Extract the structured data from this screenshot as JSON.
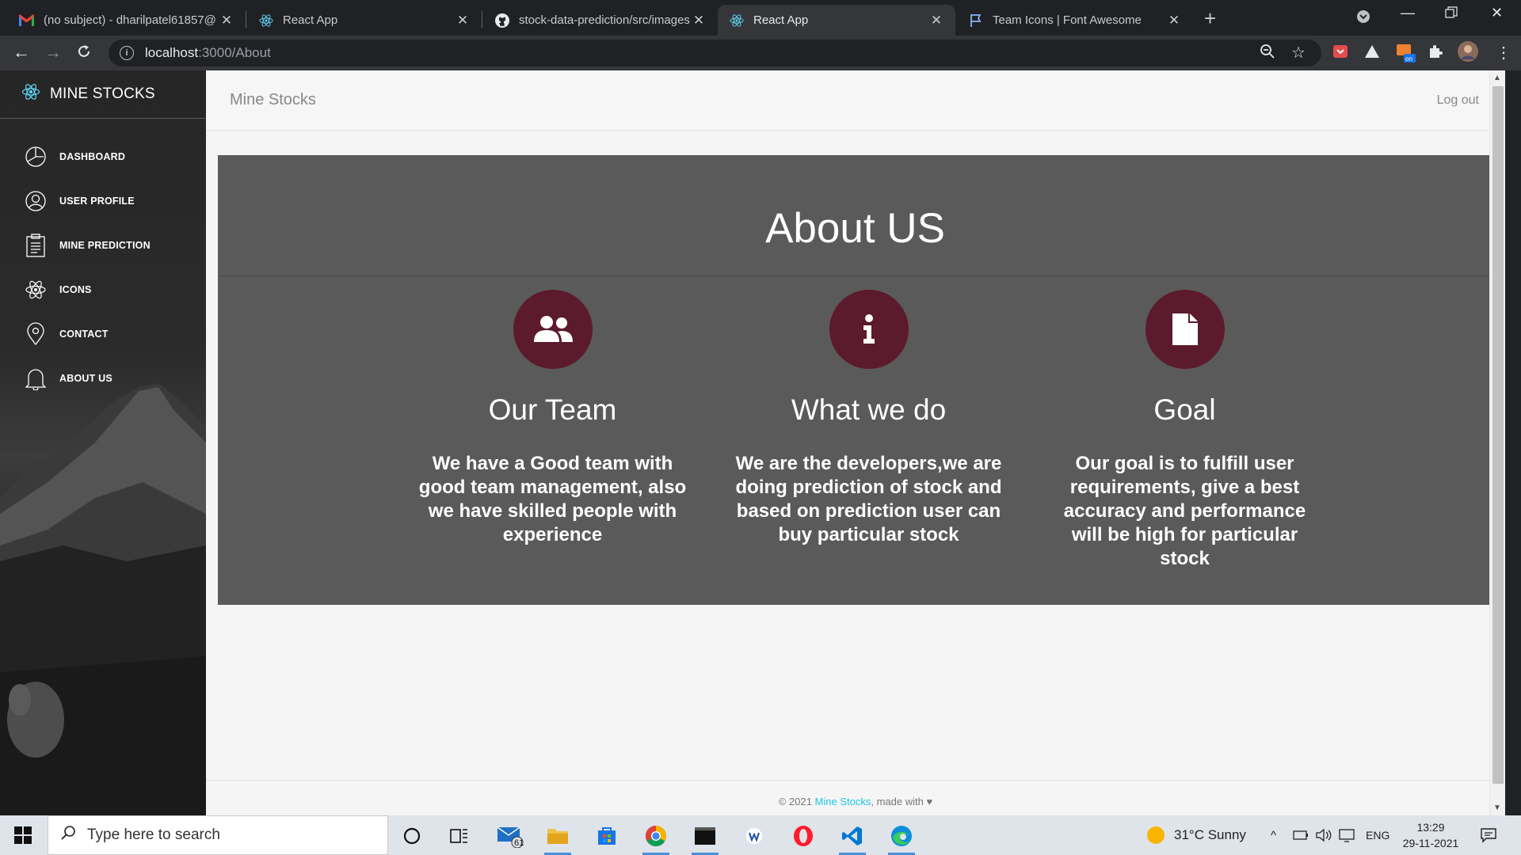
{
  "browser": {
    "tabs": [
      {
        "title": "(no subject) - dharilpatel61857@",
        "icon": "gmail-icon",
        "active": false
      },
      {
        "title": "React App",
        "icon": "react-icon",
        "active": false
      },
      {
        "title": "stock-data-prediction/src/images",
        "icon": "github-icon",
        "active": false
      },
      {
        "title": "React App",
        "icon": "react-icon",
        "active": true
      },
      {
        "title": "Team Icons | Font Awesome",
        "icon": "flag-icon",
        "active": false
      }
    ],
    "url_host": "localhost",
    "url_path": ":3000/About"
  },
  "sidebar": {
    "brand": "MINE STOCKS",
    "items": [
      {
        "label": "DASHBOARD",
        "icon": "pie-chart-icon"
      },
      {
        "label": "USER PROFILE",
        "icon": "user-circle-icon"
      },
      {
        "label": "MINE PREDICTION",
        "icon": "clipboard-icon"
      },
      {
        "label": "ICONS",
        "icon": "atom-icon"
      },
      {
        "label": "CONTACT",
        "icon": "map-pin-icon"
      },
      {
        "label": "ABOUT US",
        "icon": "bell-icon"
      }
    ]
  },
  "header": {
    "title": "Mine Stocks",
    "logout": "Log out"
  },
  "about": {
    "heading": "About US",
    "sections": [
      {
        "icon": "users-icon",
        "title": "Our Team",
        "text": "We have a Good team with good team management, also we have skilled people with experience"
      },
      {
        "icon": "info-icon",
        "title": "What we do",
        "text": "We are the developers,we are doing prediction of stock and based on prediction user can buy particular stock"
      },
      {
        "icon": "file-icon",
        "title": "Goal",
        "text": "Our goal is to fulfill user requirements, give a best accuracy and performance will be high for particular stock"
      }
    ],
    "accent_color": "#5c1a2d"
  },
  "footer": {
    "prefix": "© 2021 ",
    "link": "Mine Stocks",
    "suffix": ", made with ♥"
  },
  "taskbar": {
    "search_placeholder": "Type here to search",
    "mail_badge": "61",
    "weather": "31°C  Sunny",
    "language": "ENG",
    "time": "13:29",
    "date": "29-11-2021"
  }
}
